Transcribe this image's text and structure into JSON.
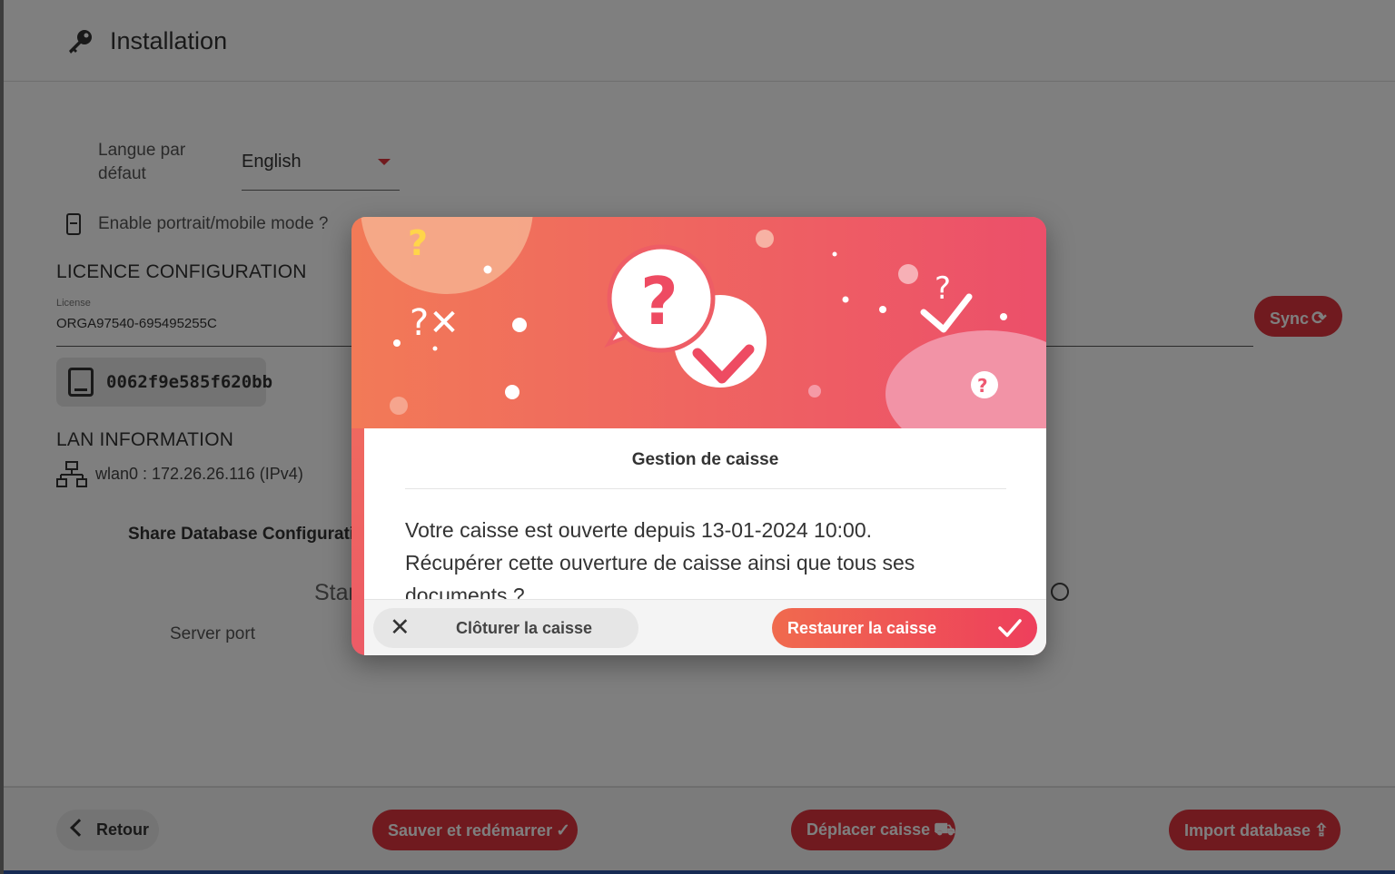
{
  "header": {
    "title": "Installation",
    "icon": "key-icon"
  },
  "settings": {
    "language_label": "Langue par défaut",
    "language_value": "English",
    "portrait_label": "Enable portrait/mobile mode ?"
  },
  "licence": {
    "section_title": "LICENCE CONFIGURATION",
    "field_label": "License",
    "field_value": "ORGA97540-695495255C",
    "sync_label": "Sync"
  },
  "device": {
    "id": "0062f9e585f620bb"
  },
  "lan": {
    "section_title": "LAN INFORMATION",
    "interface": "wlan0 : 172.26.26.116 (IPv4)"
  },
  "share_db": {
    "title": "Share Database Configuration",
    "mode_partial": "Stan",
    "server_port_label": "Server port"
  },
  "footer": {
    "back_label": "Retour",
    "save_label": "Sauver et redémarrer",
    "move_label": "Déplacer caisse",
    "import_label": "Import database"
  },
  "modal": {
    "title": "Gestion de caisse",
    "message_line1": "Votre caisse est ouverte depuis 13-01-2024 10:00.",
    "message_line2": "Récupérer cette ouverture de caisse ainsi que tous ses documents ?",
    "close_label": "Clôturer la caisse",
    "restore_label": "Restaurer la caisse"
  },
  "colors": {
    "accent_red": "#e0353f",
    "banner_start": "#f27559",
    "banner_end": "#ec4f6a",
    "overlay": "rgba(0,0,0,0.5)"
  }
}
